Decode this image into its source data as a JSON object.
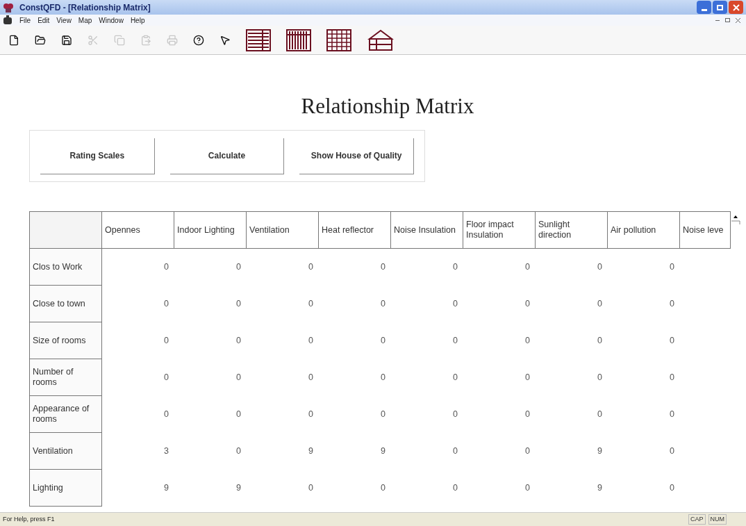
{
  "window": {
    "title": "ConstQFD - [Relationship Matrix]"
  },
  "menu": [
    "File",
    "Edit",
    "View",
    "Map",
    "Window",
    "Help"
  ],
  "toolbar": [
    {
      "kind": "new",
      "disabled": false
    },
    {
      "kind": "open",
      "disabled": false
    },
    {
      "kind": "save",
      "disabled": false
    },
    {
      "kind": "cut",
      "disabled": true
    },
    {
      "kind": "copy",
      "disabled": true
    },
    {
      "kind": "paste",
      "disabled": true
    },
    {
      "kind": "print",
      "disabled": true
    },
    {
      "kind": "help",
      "disabled": false
    },
    {
      "kind": "context-help",
      "disabled": false
    },
    {
      "kind": "rows-matrix",
      "disabled": false
    },
    {
      "kind": "columns-matrix",
      "disabled": false
    },
    {
      "kind": "grid-matrix",
      "disabled": false
    },
    {
      "kind": "house",
      "disabled": false
    }
  ],
  "heading": "Relationship Matrix",
  "buttons": [
    "Rating Scales",
    "Calculate",
    "Show House of Quality"
  ],
  "table": {
    "columns": [
      "Opennes",
      "Indoor Lighting",
      "Ventilation",
      "Heat reflector",
      "Noise Insulation",
      "Floor impact Insulation",
      "Sunlight direction",
      "Air pollution",
      "Noise leve"
    ],
    "rows": [
      {
        "label": "Clos to Work",
        "values": [
          "0",
          "0",
          "0",
          "0",
          "0",
          "0",
          "0",
          "0"
        ]
      },
      {
        "label": "Close to town",
        "values": [
          "0",
          "0",
          "0",
          "0",
          "0",
          "0",
          "0",
          "0"
        ]
      },
      {
        "label": "Size of rooms",
        "values": [
          "0",
          "0",
          "0",
          "0",
          "0",
          "0",
          "0",
          "0"
        ]
      },
      {
        "label": "Number of rooms",
        "values": [
          "0",
          "0",
          "0",
          "0",
          "0",
          "0",
          "0",
          "0"
        ]
      },
      {
        "label": "Appearance of rooms",
        "values": [
          "0",
          "0",
          "0",
          "0",
          "0",
          "0",
          "0",
          "0"
        ]
      },
      {
        "label": "Ventilation",
        "values": [
          "3",
          "0",
          "9",
          "9",
          "0",
          "0",
          "9",
          "0"
        ]
      },
      {
        "label": "Lighting",
        "values": [
          "9",
          "9",
          "0",
          "0",
          "0",
          "0",
          "9",
          "0"
        ]
      }
    ]
  },
  "status_bar": {
    "message": "For Help, press F1",
    "indicators": [
      "CAP",
      "NUM"
    ]
  }
}
